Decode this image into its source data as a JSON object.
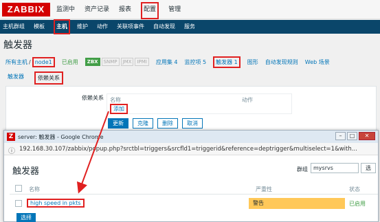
{
  "logo": "ZABBIX",
  "top_menu": [
    {
      "label": "监测中",
      "active": false
    },
    {
      "label": "资产记录",
      "active": false
    },
    {
      "label": "报表",
      "active": false
    },
    {
      "label": "配置",
      "active": true
    },
    {
      "label": "管理",
      "active": false
    }
  ],
  "sub_menu": [
    {
      "label": "主机群组",
      "active": false
    },
    {
      "label": "模板",
      "active": false
    },
    {
      "label": "主机",
      "active": true
    },
    {
      "label": "维护",
      "active": false
    },
    {
      "label": "动作",
      "active": false
    },
    {
      "label": "关联项事件",
      "active": false
    },
    {
      "label": "自动发现",
      "active": false
    },
    {
      "label": "服务",
      "active": false
    }
  ],
  "page_title": "触发器",
  "host_row": {
    "all_hosts": "所有主机",
    "separator": "/",
    "host": "node1",
    "enabled": "已启用",
    "tags": [
      "ZBX",
      "SNMP",
      "JMX",
      "IPMI"
    ],
    "links": [
      "应用集 4",
      "监控项 5",
      "触发器 1",
      "图形",
      "自动发现规则",
      "Web 场景"
    ]
  },
  "tabs": [
    "触发器",
    "依赖关系"
  ],
  "form": {
    "dep_label": "依赖关系",
    "col_name": "名称",
    "col_action": "动作",
    "add_link": "添加",
    "buttons": [
      "更新",
      "克隆",
      "删除",
      "取消"
    ]
  },
  "popup": {
    "window_title": "server: 触发器 - Google Chrome",
    "url": "192.168.30.107/zabbix/popup.php?srctbl=triggers&srcfld1=triggerid&reference=deptrigger&multiselect=1&with...",
    "heading": "触发器",
    "group_label": "群组",
    "group_value": "mysrvs",
    "select_button": "选",
    "columns": {
      "name": "名称",
      "severity": "严重性",
      "status": "状态"
    },
    "row": {
      "name": "high speed in pkts",
      "severity": "警告",
      "status": "已启用"
    },
    "choose_button": "选择"
  },
  "colors": {
    "brand_red": "#d40000",
    "nav_blue": "#0a466a",
    "link_blue": "#0275b8",
    "highlight_red": "#e02020",
    "warning_yellow": "#ffc859",
    "enabled_green": "#429e47"
  }
}
